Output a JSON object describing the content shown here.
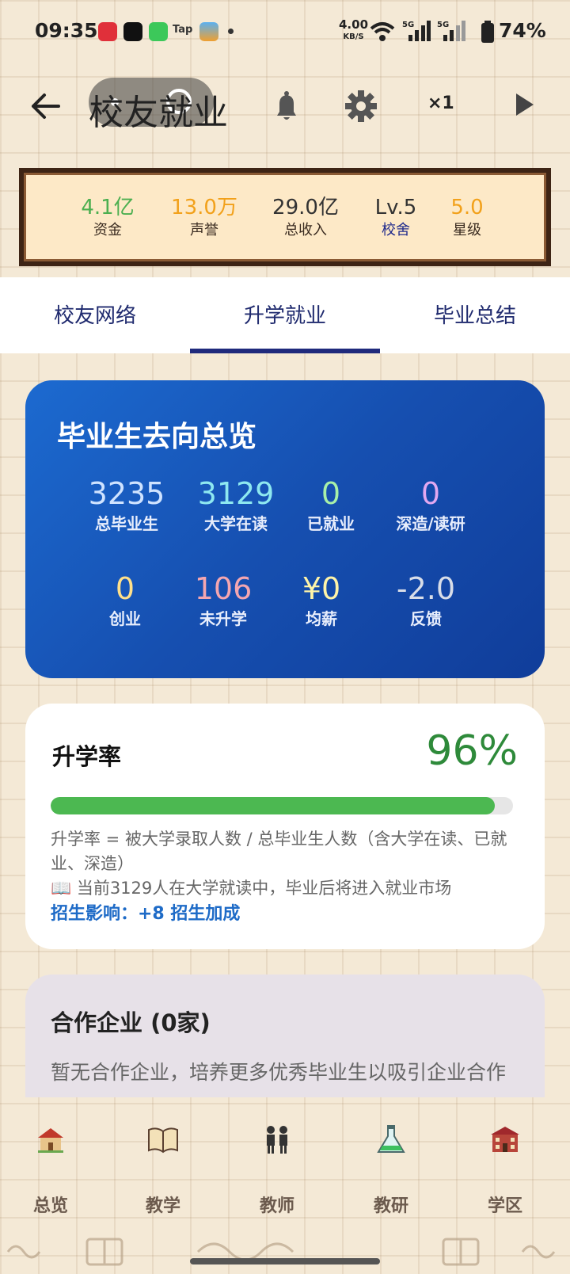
{
  "status_bar": {
    "time": "09:35",
    "net_speed": "4.00",
    "net_unit": "KB/S",
    "battery": "74%"
  },
  "header": {
    "title": "校友就业",
    "speed": "×1"
  },
  "stats": [
    {
      "value": "4.1亿",
      "label": "资金",
      "color": "#4caf50"
    },
    {
      "value": "13.0万",
      "label": "声誉",
      "color": "#f2a11b"
    },
    {
      "value": "29.0亿",
      "label": "总收入",
      "color": "#333333"
    },
    {
      "value": "Lv.5",
      "label": "校舍",
      "color": "#333333"
    },
    {
      "value": "5.0",
      "label": "星级",
      "color": "#f2a11b"
    }
  ],
  "tabs": [
    "校友网络",
    "升学就业",
    "毕业总结"
  ],
  "active_tab": 1,
  "overview": {
    "title": "毕业生去向总览",
    "items": [
      {
        "value": "3235",
        "label": "总毕业生",
        "color": "#cfe3ff"
      },
      {
        "value": "3129",
        "label": "大学在读",
        "color": "#8ee8f0"
      },
      {
        "value": "0",
        "label": "已就业",
        "color": "#a8f0a8"
      },
      {
        "value": "0",
        "label": "深造/读研",
        "color": "#e3a8f0"
      },
      {
        "value": "0",
        "label": "创业",
        "color": "#ffe08a"
      },
      {
        "value": "106",
        "label": "未升学",
        "color": "#f4a6b0"
      },
      {
        "value": "¥0",
        "label": "均薪",
        "color": "#fff4a8"
      },
      {
        "value": "-2.0",
        "label": "反馈",
        "color": "#d8dde8"
      }
    ]
  },
  "enrollment": {
    "title": "升学率",
    "percent": "96%",
    "progress": 0.96,
    "desc1": "升学率 = 被大学录取人数 / 总毕业生人数（含大学在读、已就业、深造）",
    "desc2": "📖 当前3129人在大学就读中，毕业后将进入就业市场",
    "impact": "招生影响：+8 招生加成"
  },
  "partners": {
    "title": "合作企业 (0家)",
    "text": "暂无合作企业，培养更多优秀毕业生以吸引企业合作"
  },
  "bottom_nav": [
    {
      "label": "总览",
      "icon": "school-house-icon"
    },
    {
      "label": "教学",
      "icon": "open-book-icon"
    },
    {
      "label": "教师",
      "icon": "teachers-icon"
    },
    {
      "label": "教研",
      "icon": "flask-icon"
    },
    {
      "label": "学区",
      "icon": "school-building-icon"
    }
  ]
}
